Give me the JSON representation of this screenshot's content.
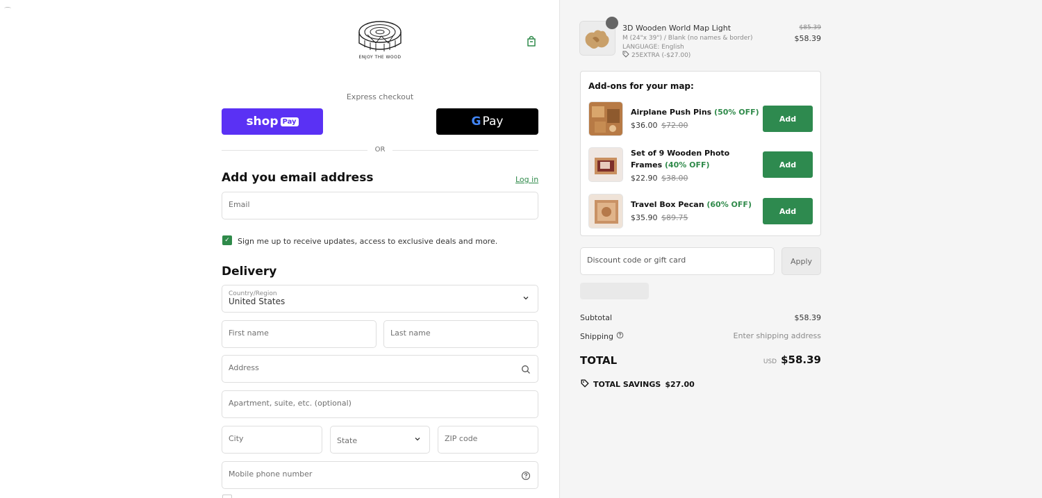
{
  "brand": {
    "logo_text": "ENJOY THE WOOD",
    "accent_color": "#2f8a4a"
  },
  "express": {
    "label": "Express checkout",
    "shop_pay_text": "shop",
    "shop_pay_badge": "Pay",
    "gpay_g": "G",
    "gpay_text": "Pay",
    "or_text": "OR"
  },
  "contact": {
    "title": "Add you email address",
    "login_link": "Log in",
    "email_placeholder": "Email",
    "newsletter_label": "Sign me up to receive updates, access to exclusive deals and more.",
    "newsletter_checked": true
  },
  "delivery": {
    "title": "Delivery",
    "country_label": "Country/Region",
    "country_value": "United States",
    "first_name_placeholder": "First name",
    "last_name_placeholder": "Last name",
    "address_placeholder": "Address",
    "apartment_placeholder": "Apartment, suite, etc. (optional)",
    "city_placeholder": "City",
    "state_placeholder": "State",
    "zip_placeholder": "ZIP code",
    "phone_placeholder": "Mobile phone number"
  },
  "order": {
    "item": {
      "title": "3D Wooden World Map Light",
      "variant": "M (24\"x 39\") / Blank (no names & border)",
      "language": "LANGUAGE: English",
      "discount": "25EXTRA (-$27.00)",
      "old_price": "$85.39",
      "price": "$58.39"
    },
    "addons": {
      "title": "Add-ons for your map:",
      "items": [
        {
          "name": "Airplane Push Pins ",
          "pct": "(50% OFF)",
          "price": "$36.00",
          "old_price": "$72.00",
          "button": "Add"
        },
        {
          "name": "Set of 9 Wooden Photo Frames ",
          "pct": "(40% OFF)",
          "price": "$22.90",
          "old_price": "$38.00",
          "button": "Add"
        },
        {
          "name": "Travel Box Pecan ",
          "pct": "(60% OFF)",
          "price": "$35.90",
          "old_price": "$89.75",
          "button": "Add"
        }
      ]
    },
    "discount_placeholder": "Discount code or gift card",
    "apply_label": "Apply",
    "subtotal_label": "Subtotal",
    "subtotal_value": "$58.39",
    "shipping_label": "Shipping",
    "shipping_value": "Enter shipping address",
    "total_label": "TOTAL",
    "total_currency": "USD",
    "total_value": "$58.39",
    "savings_label": "TOTAL SAVINGS",
    "savings_value": "$27.00"
  }
}
